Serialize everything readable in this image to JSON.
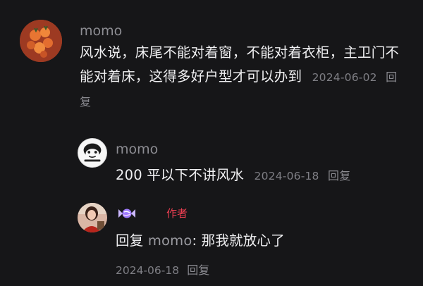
{
  "comments": [
    {
      "username": "momo",
      "text": "风水说，床尾不能对着窗，不能对着衣柜，主卫门不能对着床，这得多好户型才可以办到",
      "date": "2024-06-02",
      "reply_label": "回复",
      "avatar_icon": "orange-persimmons-avatar"
    }
  ],
  "replies": [
    {
      "username": "momo",
      "text": "200 平以下不讲风水",
      "date": "2024-06-18",
      "reply_label": "回复",
      "avatar_icon": "cartoon-face-avatar"
    },
    {
      "username_icon": "candy-emoji-icon",
      "author_badge": "作者",
      "reply_prefix": "回复",
      "mention": "momo",
      "text": ": 那我就放心了",
      "date": "2024-06-18",
      "reply_label": "回复",
      "avatar_icon": "portrait-photo-avatar"
    }
  ]
}
